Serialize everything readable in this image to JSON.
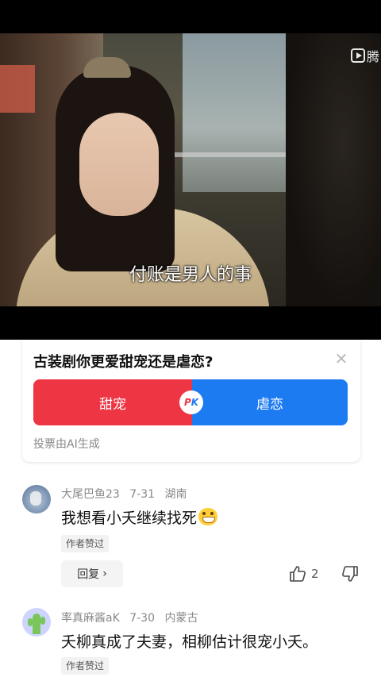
{
  "video": {
    "subtitle": "付账是男人的事",
    "watermark": "腾",
    "icon": "tencent-video-logo-icon"
  },
  "poll": {
    "question": "古装剧你更爱甜宠还是虐恋?",
    "option_a": "甜宠",
    "option_b": "虐恋",
    "pk_p": "P",
    "pk_k": "K",
    "note": "投票由AI生成",
    "colors": {
      "option_a": "#ee3543",
      "option_b": "#1d7bf2"
    }
  },
  "comments": [
    {
      "user": "大尾巴鱼23",
      "date": "7-31",
      "location": "湖南",
      "text": "我想看小夭继续找死",
      "badge": "作者赞过",
      "reply_label": "回复",
      "likes": "2"
    },
    {
      "user": "率真麻酱aK",
      "date": "7-30",
      "location": "内蒙古",
      "text": "夭柳真成了夫妻，相柳估计很宠小夭。",
      "badge": "作者赞过"
    }
  ]
}
